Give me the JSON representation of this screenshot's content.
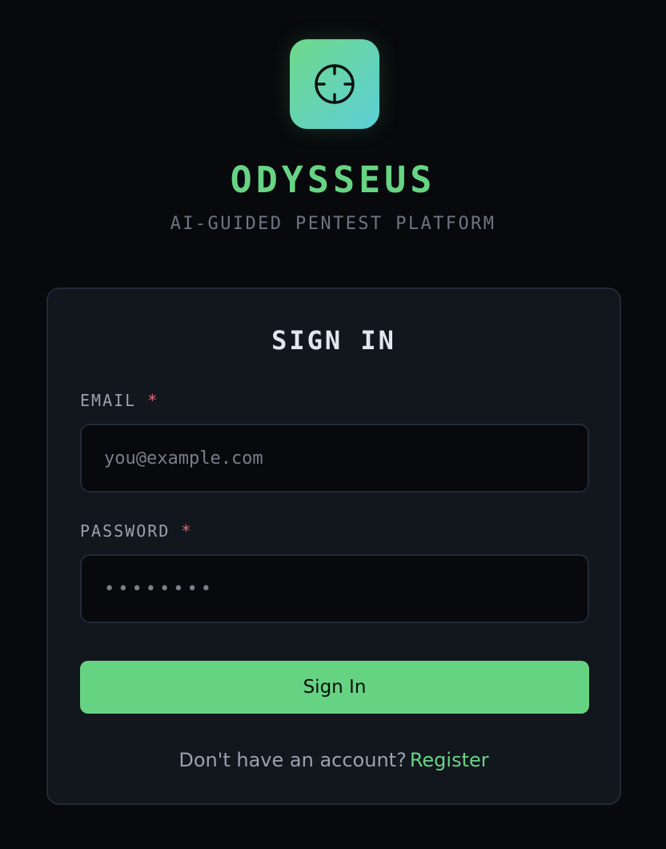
{
  "brand": {
    "name": "ODYSSEUS",
    "tagline": "AI-GUIDED PENTEST PLATFORM",
    "logo_icon": "crosshair-icon",
    "accent_color": "#67d484"
  },
  "signin_card": {
    "title": "SIGN IN",
    "email": {
      "label": "EMAIL",
      "required_mark": "*",
      "placeholder": "you@example.com",
      "value": ""
    },
    "password": {
      "label": "PASSWORD",
      "required_mark": "*",
      "placeholder": "••••••••",
      "value": ""
    },
    "submit_label": "Sign In",
    "register_prompt": "Don't have an account?",
    "register_link": "Register"
  },
  "colors": {
    "background": "#07090c",
    "card": "#12161d",
    "border": "#232a36",
    "required": "#e06c78"
  }
}
